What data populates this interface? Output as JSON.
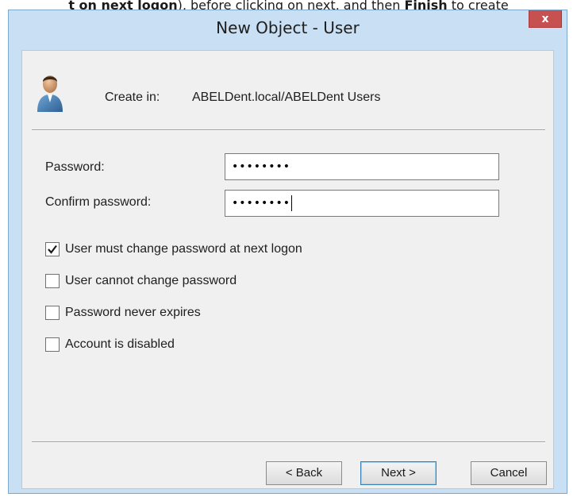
{
  "background_text": {
    "prefix_bold": "t on next logon",
    "middle": "), before clicking on next, and then ",
    "finish_bold": "Finish",
    "suffix": " to create"
  },
  "dialog": {
    "title": "New Object - User",
    "close_label": "x"
  },
  "header": {
    "create_in_label": "Create in:",
    "create_in_path": "ABELDent.local/ABELDent Users"
  },
  "form": {
    "password_label": "Password:",
    "password_value": "••••••••",
    "confirm_label": "Confirm password:",
    "confirm_value": "••••••••"
  },
  "options": [
    {
      "label": "User must change password at next logon",
      "checked": true
    },
    {
      "label": "User cannot change password",
      "checked": false
    },
    {
      "label": "Password never expires",
      "checked": false
    },
    {
      "label": "Account is disabled",
      "checked": false
    }
  ],
  "buttons": {
    "back": "< Back",
    "next": "Next >",
    "cancel": "Cancel"
  }
}
